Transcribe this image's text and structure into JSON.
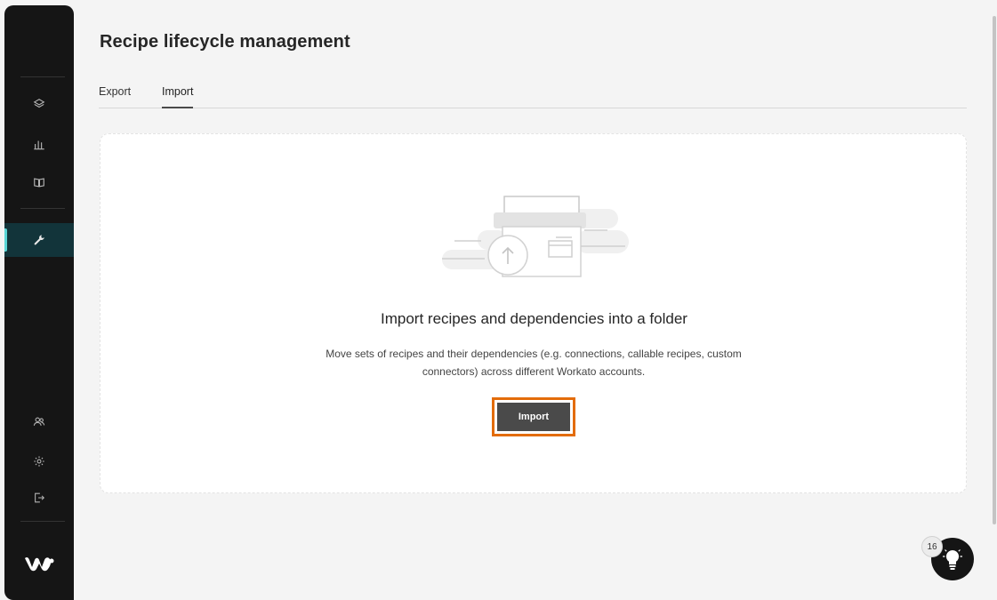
{
  "header": {
    "title": "Recipe lifecycle management"
  },
  "tabs": [
    {
      "label": "Export",
      "active": false
    },
    {
      "label": "Import",
      "active": true
    }
  ],
  "empty_state": {
    "title": "Import recipes and dependencies into a folder",
    "description_line1": "Move sets of recipes and their dependencies (e.g. connections, callable recipes, custom",
    "description_line2": "connectors) across different Workato accounts.",
    "button_label": "Import"
  },
  "sidebar": {
    "items": [
      {
        "icon": "layers-icon"
      },
      {
        "icon": "bar-chart-icon"
      },
      {
        "icon": "book-icon"
      },
      {
        "icon": "wrench-icon",
        "active": true
      },
      {
        "icon": "users-icon"
      },
      {
        "icon": "gear-icon"
      },
      {
        "icon": "logout-icon"
      }
    ],
    "logo": "workato-logo"
  },
  "help": {
    "badge_count": "16",
    "icon": "lightbulb-icon"
  },
  "colors": {
    "sidebar_bg": "#151515",
    "active_accent": "#5ad6d6",
    "highlight_border": "#e36c0a",
    "button_bg": "#4a4a4a"
  }
}
